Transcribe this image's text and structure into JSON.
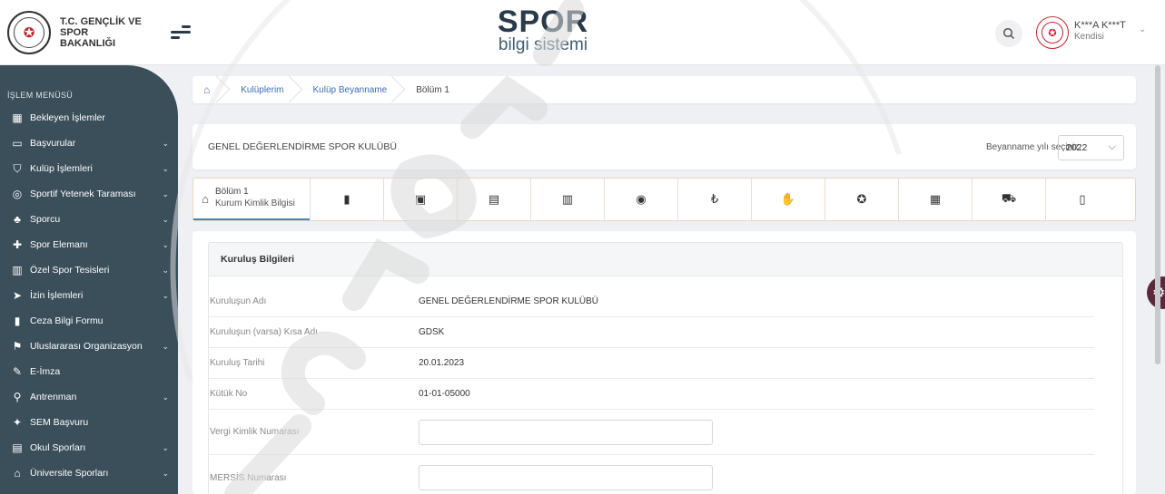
{
  "header": {
    "ministry_name_line1": "T.C. GENÇLİK VE",
    "ministry_name_line2": "SPOR BAKANLIĞI",
    "logo_main": "SPOR",
    "logo_sub": "bilgi sistemi",
    "user_name": "K***A K***T",
    "user_role": "Kendisi",
    "icons": {
      "menu": "hamburger-icon",
      "search": "search-icon",
      "avatar": "ministry-seal-icon",
      "user_menu": "chevron-down-icon"
    }
  },
  "sidebar": {
    "title": "İŞLEM MENÜSÜ",
    "items": [
      {
        "label": "Bekleyen İşlemler",
        "icon": "pending-tasks-icon",
        "expandable": false
      },
      {
        "label": "Başvurular",
        "icon": "applications-icon",
        "expandable": true
      },
      {
        "label": "Kulüp İşlemleri",
        "icon": "club-shield-icon",
        "expandable": true
      },
      {
        "label": "Sportif Yetenek Taraması",
        "icon": "talent-scan-icon",
        "expandable": true
      },
      {
        "label": "Sporcu",
        "icon": "athletes-icon",
        "expandable": true
      },
      {
        "label": "Spor Elemanı",
        "icon": "staff-add-icon",
        "expandable": true
      },
      {
        "label": "Özel Spor Tesisleri",
        "icon": "facilities-icon",
        "expandable": true
      },
      {
        "label": "İzin İşlemleri",
        "icon": "permission-icon",
        "expandable": true
      },
      {
        "label": "Ceza Bilgi Formu",
        "icon": "penalty-form-icon",
        "expandable": false
      },
      {
        "label": "Uluslararası Organizasyon",
        "icon": "flag-icon",
        "expandable": true
      },
      {
        "label": "E-İmza",
        "icon": "signature-icon",
        "expandable": false
      },
      {
        "label": "Antrenman",
        "icon": "bicycle-icon",
        "expandable": true
      },
      {
        "label": "SEM Başvuru",
        "icon": "sem-icon",
        "expandable": false
      },
      {
        "label": "Okul Sporları",
        "icon": "school-sports-icon",
        "expandable": true
      },
      {
        "label": "Üniversite Sporları",
        "icon": "graduation-cap-icon",
        "expandable": true
      }
    ]
  },
  "breadcrumb": {
    "home_icon": "home-icon",
    "items": [
      "Kulüplerim",
      "Kulüp Beyanname",
      "Bölüm 1"
    ]
  },
  "title_card": {
    "club_name": "GENEL DEĞERLENDİRME SPOR KULÜBÜ",
    "year_label": "Beyanname yılı seçiniz:",
    "year_value": "2022"
  },
  "tabs": {
    "active_title": "Bölüm 1",
    "active_subtitle": "Kurum Kimlik Bilgisi",
    "icons": [
      "document-icon",
      "id-card-icon",
      "form-list-icon",
      "building-icon",
      "globe-icon",
      "lira-icon",
      "handshake-icon",
      "award-icon",
      "gift-icon",
      "car-icon",
      "clipboard-icon"
    ]
  },
  "panel": {
    "title": "Kuruluş Bilgileri",
    "rows": [
      {
        "label": "Kuruluşun Adı",
        "value": "GENEL DEĞERLENDİRME SPOR KULÜBÜ"
      },
      {
        "label": "Kuruluşun (varsa) Kısa Adı",
        "value": "GDSK"
      },
      {
        "label": "Kuruluş Tarihi",
        "value": "20.01.2023"
      },
      {
        "label": "Kütük No",
        "value": "01-01-05000"
      }
    ],
    "inputs": [
      {
        "label": "Vergi Kimlik Numarası",
        "value": ""
      },
      {
        "label": "MERSİS Numarası",
        "value": ""
      }
    ]
  },
  "colors": {
    "sidebar_bg": "#3a4f5a",
    "accent_blue": "#4e80b9",
    "brand_red": "#c0262d",
    "settings_fab": "#5a2a3c"
  }
}
